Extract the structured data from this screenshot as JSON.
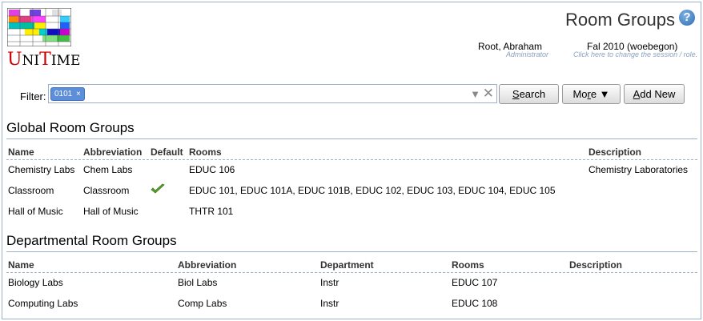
{
  "app": {
    "logo_text_u1": "U",
    "logo_text_n1": "NI",
    "logo_text_t": "T",
    "logo_text_ime": "IME"
  },
  "header": {
    "title": "Room Groups",
    "help_glyph": "?",
    "user_name": "Root, Abraham",
    "user_role": "Administrator",
    "session_name": "Fal 2010 (woebegon)",
    "session_hint": "Click here to change the session / role."
  },
  "filter": {
    "label": "Filter:",
    "chip": "0101",
    "chip_remove": "×",
    "dropdown_glyph": "▼",
    "clear_glyph": "✕"
  },
  "buttons": {
    "search_acc": "S",
    "search_rest": "earch",
    "more_pre": "Mo",
    "more_acc": "r",
    "more_post": "e ▼",
    "add_acc": "A",
    "add_rest": "dd New"
  },
  "global": {
    "title": "Global Room Groups",
    "headers": {
      "name": "Name",
      "abbr": "Abbreviation",
      "default": "Default",
      "rooms": "Rooms",
      "desc": "Description"
    },
    "rows": [
      {
        "name": "Chemistry Labs",
        "abbr": "Chem Labs",
        "default": false,
        "rooms": "EDUC 106",
        "desc": "Chemistry Laboratories"
      },
      {
        "name": "Classroom",
        "abbr": "Classroom",
        "default": true,
        "rooms": "EDUC 101, EDUC 101A, EDUC 101B, EDUC 102, EDUC 103, EDUC 104, EDUC 105",
        "desc": ""
      },
      {
        "name": "Hall of Music",
        "abbr": "Hall of Music",
        "default": false,
        "rooms": "THTR 101",
        "desc": ""
      }
    ]
  },
  "departmental": {
    "title": "Departmental Room Groups",
    "headers": {
      "name": "Name",
      "abbr": "Abbreviation",
      "dept": "Department",
      "rooms": "Rooms",
      "desc": "Description"
    },
    "rows": [
      {
        "name": "Biology Labs",
        "abbr": "Biol Labs",
        "dept": "Instr",
        "rooms": "EDUC 107",
        "desc": ""
      },
      {
        "name": "Computing Labs",
        "abbr": "Comp Labs",
        "dept": "Instr",
        "rooms": "EDUC 108",
        "desc": ""
      }
    ]
  },
  "colors": {
    "accent": "#9cb0ce",
    "chip": "#5d8ed9",
    "check": "#5aa02c",
    "logo_red": "#cc0000"
  }
}
